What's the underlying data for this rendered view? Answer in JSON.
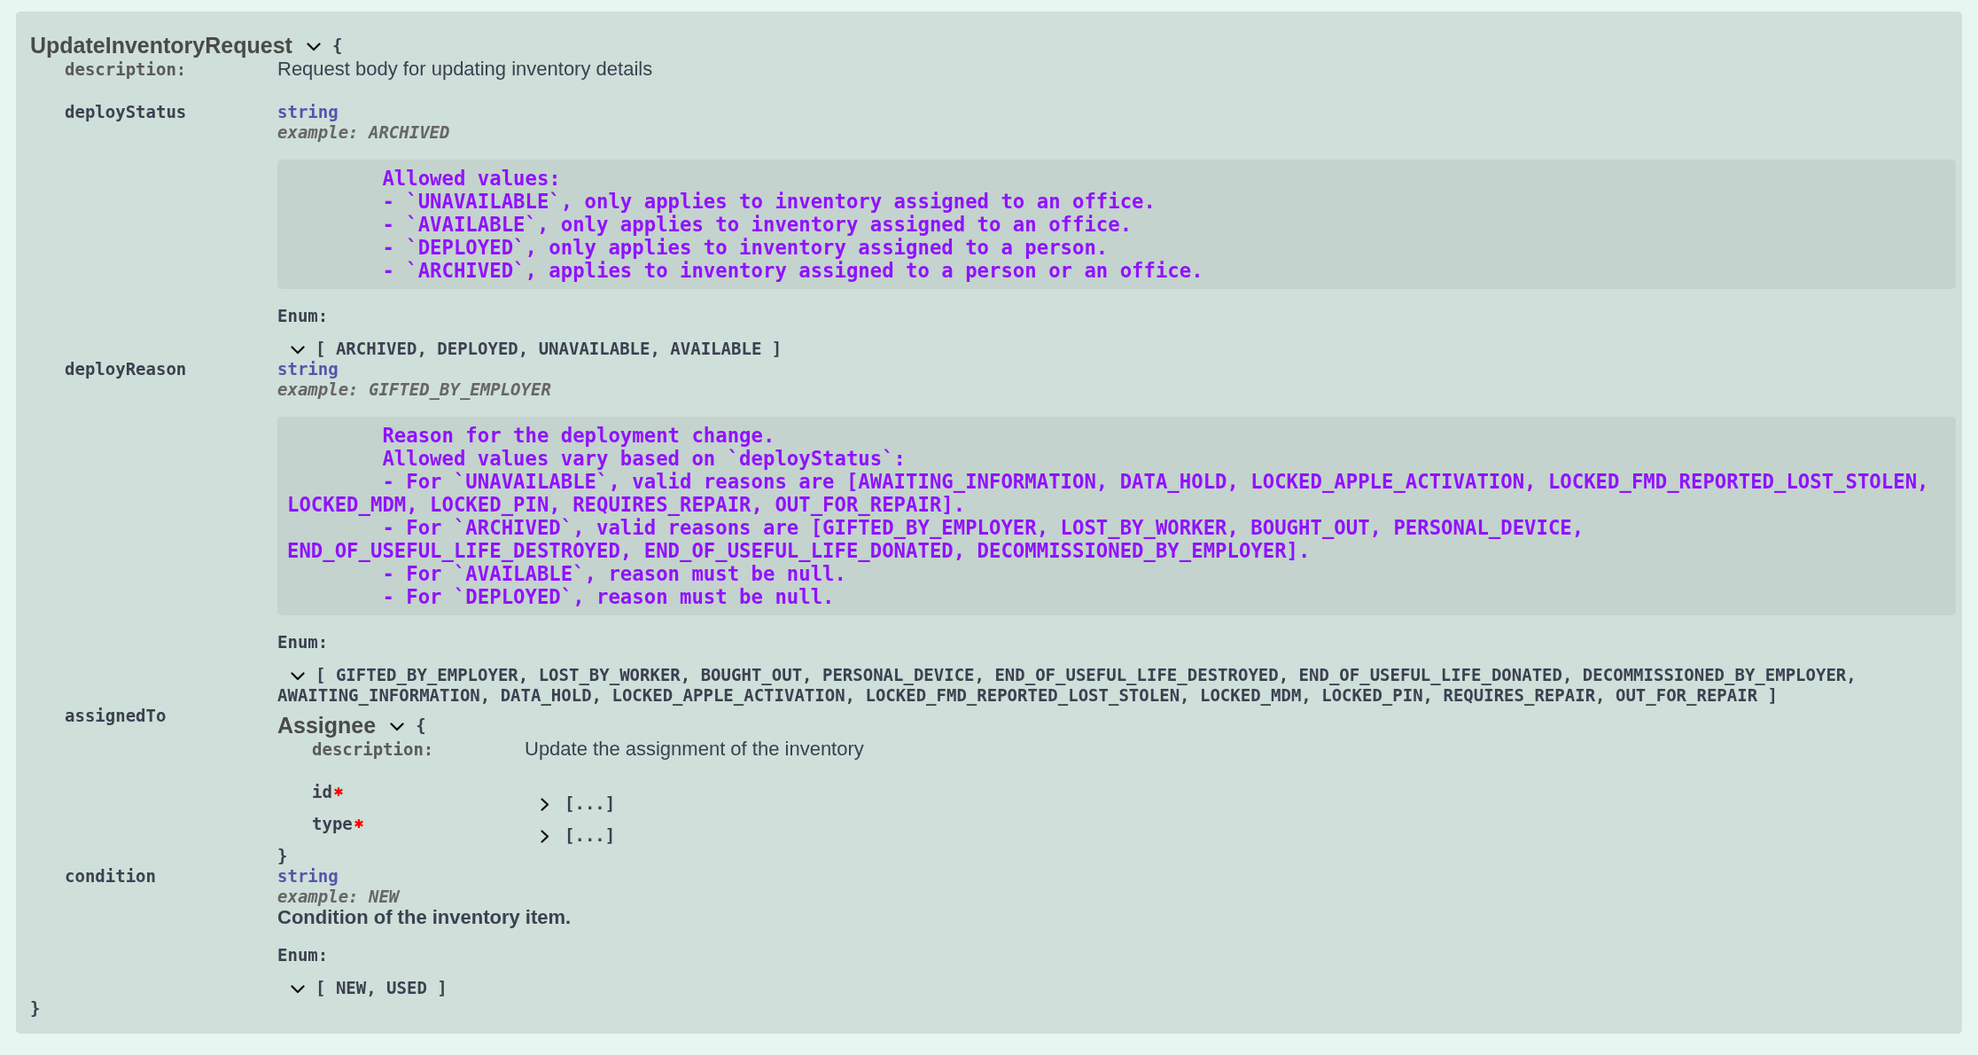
{
  "schema": {
    "title": "UpdateInventoryRequest",
    "expanded": true,
    "open_brace": "{",
    "description_label": "description:",
    "description": "Request body for updating inventory details",
    "properties": [
      {
        "name": "deployStatus",
        "kind": "primitive",
        "type": "string",
        "example": "example: ARCHIVED",
        "notes": "        Allowed values:\n        - `UNAVAILABLE`, only applies to inventory assigned to an office.\n        - `AVAILABLE`, only applies to inventory assigned to an office.\n        - `DEPLOYED`, only applies to inventory assigned to a person.\n        - `ARCHIVED`, applies to inventory assigned to a person or an office.",
        "enum_label": "Enum:",
        "enum_expanded": true,
        "enum_lines": [
          "[ ARCHIVED, DEPLOYED, UNAVAILABLE, AVAILABLE ]"
        ]
      },
      {
        "name": "deployReason",
        "kind": "primitive",
        "type": "string",
        "example": "example: GIFTED_BY_EMPLOYER",
        "notes": "        Reason for the deployment change.\n        Allowed values vary based on `deployStatus`:\n        - For `UNAVAILABLE`, valid reasons are [AWAITING_INFORMATION, DATA_HOLD, LOCKED_APPLE_ACTIVATION, LOCKED_FMD_REPORTED_LOST_STOLEN,\nLOCKED_MDM, LOCKED_PIN, REQUIRES_REPAIR, OUT_FOR_REPAIR].\n        - For `ARCHIVED`, valid reasons are [GIFTED_BY_EMPLOYER, LOST_BY_WORKER, BOUGHT_OUT, PERSONAL_DEVICE,\nEND_OF_USEFUL_LIFE_DESTROYED, END_OF_USEFUL_LIFE_DONATED, DECOMMISSIONED_BY_EMPLOYER].\n        - For `AVAILABLE`, reason must be null.\n        - For `DEPLOYED`, reason must be null.",
        "enum_label": "Enum:",
        "enum_expanded": true,
        "enum_lines": [
          "[ GIFTED_BY_EMPLOYER, LOST_BY_WORKER, BOUGHT_OUT, PERSONAL_DEVICE, END_OF_USEFUL_LIFE_DESTROYED, END_OF_USEFUL_LIFE_DONATED, DECOMMISSIONED_BY_EMPLOYER,",
          "AWAITING_INFORMATION, DATA_HOLD, LOCKED_APPLE_ACTIVATION, LOCKED_FMD_REPORTED_LOST_STOLEN, LOCKED_MDM, LOCKED_PIN, REQUIRES_REPAIR, OUT_FOR_REPAIR ]"
        ]
      },
      {
        "name": "assignedTo",
        "kind": "object",
        "model": {
          "title": "Assignee",
          "expanded": true,
          "open_brace": "{",
          "description_label": "description:",
          "description": "Update the assignment of the inventory",
          "properties": [
            {
              "name": "id",
              "required": true,
              "kind": "collapsed",
              "expanded": false,
              "value": "[...]"
            },
            {
              "name": "type",
              "required": true,
              "kind": "collapsed",
              "expanded": false,
              "value": "[...]"
            }
          ],
          "close_brace": "}"
        }
      },
      {
        "name": "condition",
        "kind": "primitive",
        "type": "string",
        "example": "example: NEW",
        "description": "Condition of the inventory item.",
        "enum_label": "Enum:",
        "enum_expanded": true,
        "enum_lines": [
          "[ NEW, USED ]"
        ]
      }
    ],
    "close_brace": "}"
  }
}
